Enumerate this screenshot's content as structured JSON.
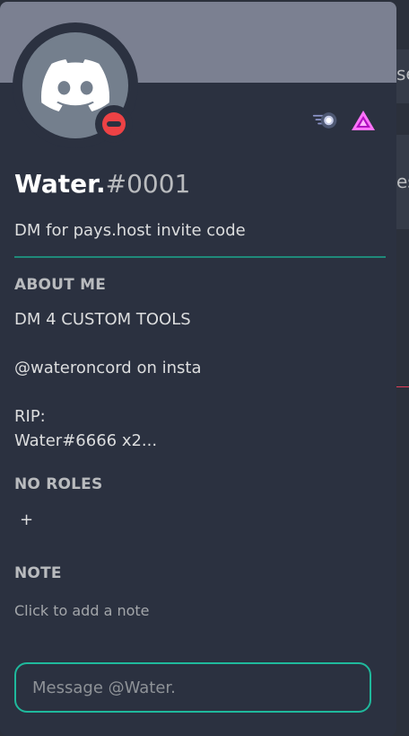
{
  "background": {
    "text_1": "se",
    "text_2": "es"
  },
  "profile": {
    "username": "Water.",
    "discriminator": "#0001",
    "custom_status": "DM for pays.host invite code",
    "status": "do-not-disturb",
    "avatar_icon": "discord-logo-icon",
    "badges": [
      "hypesquad-brilliance-icon",
      "nitro-boost-icon"
    ]
  },
  "about": {
    "title": "ABOUT ME",
    "lines": [
      "DM 4 CUSTOM TOOLS",
      "@wateroncord on insta",
      "RIP:",
      "Water#6666 x2..."
    ]
  },
  "roles": {
    "title": "NO ROLES",
    "add_label": "+"
  },
  "note": {
    "title": "NOTE",
    "placeholder": "Click to add a note"
  },
  "message": {
    "placeholder": "Message @Water."
  },
  "colors": {
    "card_bg": "#2b3140",
    "banner": "#7b8091",
    "avatar_bg": "#747f8d",
    "accent_teal": "#1fb99c",
    "dnd_red": "#ed4245"
  }
}
